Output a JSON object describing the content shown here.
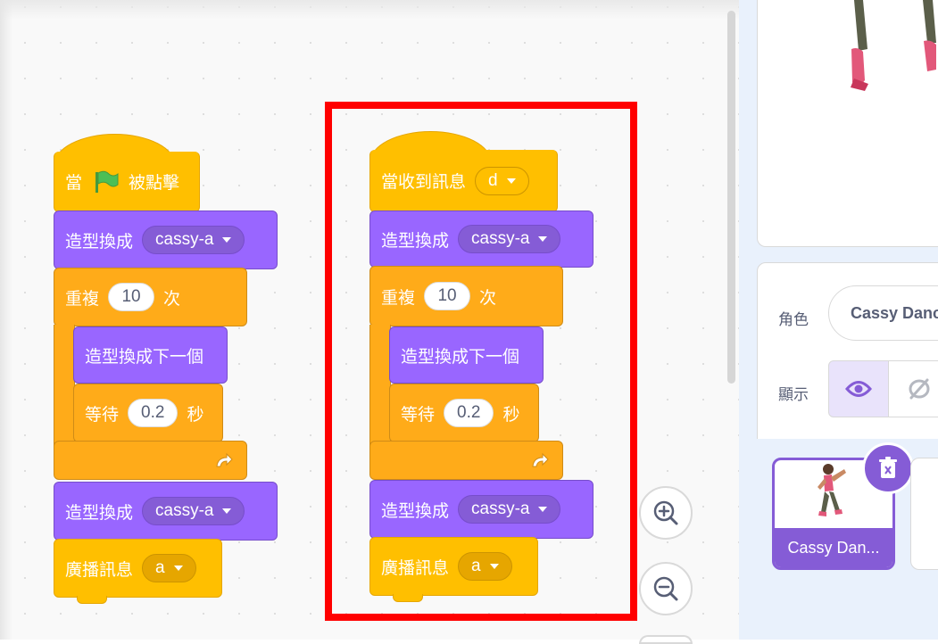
{
  "left_script": {
    "when_flag_prefix": "當",
    "when_flag_suffix": "被點擊",
    "switch_costume_1": {
      "label": "造型換成",
      "value": "cassy-a"
    },
    "repeat": {
      "label": "重複",
      "count": "10",
      "suffix": "次"
    },
    "next_costume": "造型換成下一個",
    "wait": {
      "label": "等待",
      "seconds": "0.2",
      "suffix": "秒"
    },
    "switch_costume_2": {
      "label": "造型換成",
      "value": "cassy-a"
    },
    "broadcast": {
      "label": "廣播訊息",
      "value": "a"
    }
  },
  "right_script": {
    "when_receive": {
      "label": "當收到訊息",
      "value": "d"
    },
    "switch_costume_1": {
      "label": "造型換成",
      "value": "cassy-a"
    },
    "repeat": {
      "label": "重複",
      "count": "10",
      "suffix": "次"
    },
    "next_costume": "造型換成下一個",
    "wait": {
      "label": "等待",
      "seconds": "0.2",
      "suffix": "秒"
    },
    "switch_costume_2": {
      "label": "造型換成",
      "value": "cassy-a"
    },
    "broadcast": {
      "label": "廣播訊息",
      "value": "a"
    }
  },
  "sprite_info": {
    "sprite_label": "角色",
    "sprite_name": "Cassy Dance",
    "show_label": "顯示"
  },
  "sprite_list": {
    "selected_sprite_label": "Cassy Dan..."
  },
  "icons": [
    "green-flag-icon",
    "dropdown-arrow-icon",
    "repeat-arrow-icon",
    "zoom-in-icon",
    "zoom-out-icon",
    "eye-icon",
    "eye-hidden-icon",
    "trash-icon"
  ],
  "colors": {
    "events": "#ffbf00",
    "looks": "#9966ff",
    "control": "#ffab19",
    "highlight": "#ff0000",
    "accent": "#855cd6"
  }
}
